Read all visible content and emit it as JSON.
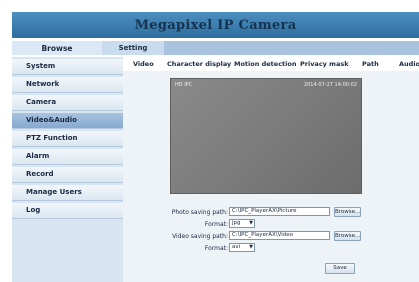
{
  "header": {
    "title": "Megapixel IP Camera"
  },
  "tabs": {
    "browse": "Browse",
    "setting": "Setting"
  },
  "sidebar": {
    "items": [
      {
        "label": "System"
      },
      {
        "label": "Network"
      },
      {
        "label": "Camera"
      },
      {
        "label": "Video&Audio",
        "active": true
      },
      {
        "label": "PTZ Function"
      },
      {
        "label": "Alarm"
      },
      {
        "label": "Record"
      },
      {
        "label": "Manage Users"
      },
      {
        "label": "Log"
      }
    ]
  },
  "subtabs": [
    "Video",
    "Character display",
    "Motion detection",
    "Privacy mask",
    "Path",
    "Audio"
  ],
  "preview": {
    "overlay_left": "HD IPC",
    "overlay_right": "2014-07-27 14:00:02"
  },
  "form": {
    "photo_path_label": "Photo saving path:",
    "photo_path_value": "C:\\IPC_PlayerAX\\Picture",
    "photo_browse": "Browse...",
    "photo_format_label": "Format:",
    "photo_format_value": "jpg",
    "video_path_label": "Video saving path:",
    "video_path_value": "C:\\IPC_PlayerAX\\Video",
    "video_browse": "Browse...",
    "video_format_label": "Format:",
    "video_format_value": "avi",
    "save_label": "Save"
  },
  "colors": {
    "header": "#3d7fb0",
    "sidebar_active": "#97b6d7",
    "content_bg": "#eef3f8"
  }
}
